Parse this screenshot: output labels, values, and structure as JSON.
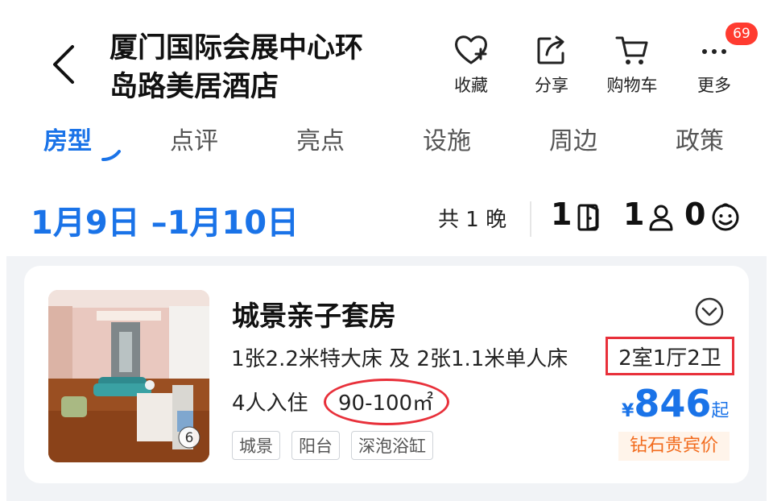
{
  "header": {
    "title_line1": "厦门国际会展中心环",
    "title_line2": "岛路美居酒店",
    "actions": [
      {
        "label": "收藏",
        "icon": "heart-plus-icon"
      },
      {
        "label": "分享",
        "icon": "share-icon"
      },
      {
        "label": "购物车",
        "icon": "cart-icon"
      },
      {
        "label": "更多",
        "icon": "more-icon"
      }
    ],
    "badge": "69"
  },
  "tabs": [
    "房型",
    "点评",
    "亮点",
    "设施",
    "周边",
    "政策"
  ],
  "active_tab": "房型",
  "booking": {
    "dates": "1月9日 –1月10日",
    "nights": "共 1 晚",
    "rooms": "1",
    "adults": "1",
    "children": "0"
  },
  "room": {
    "name": "城景亲子套房",
    "beds": "1张2.2米特大床 及 2张1.1米单人床",
    "layout": "2室1厅2卫",
    "occupancy": "4人入住",
    "area": "90-100㎡",
    "photo_count": "6",
    "tags": [
      "城景",
      "阳台",
      "深泡浴缸"
    ],
    "price_currency": "¥",
    "price": "846",
    "price_suffix": "起",
    "member_label": "钻石贵宾价"
  },
  "colors": {
    "accent": "#1a73e8",
    "highlight_red": "#e8303a",
    "badge_red": "#ff3b30",
    "member_orange": "#f26b1d",
    "member_bg": "#fff4ea"
  }
}
